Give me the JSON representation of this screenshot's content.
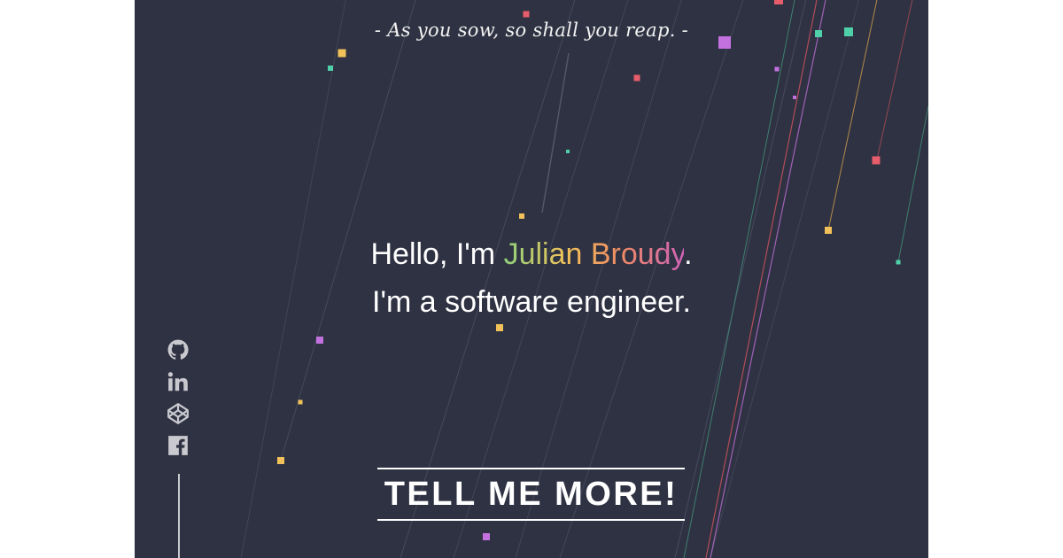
{
  "quote": "- As you sow, so shall you reap. -",
  "headline": {
    "greeting_prefix": "Hello, I'm ",
    "name": "Julian Broudy",
    "greeting_suffix": ".",
    "tagline": "I'm a software engineer."
  },
  "social": [
    {
      "name": "github",
      "icon": "github-icon"
    },
    {
      "name": "linkedin",
      "icon": "linkedin-icon"
    },
    {
      "name": "codepen",
      "icon": "codepen-icon"
    },
    {
      "name": "facebook",
      "icon": "facebook-icon"
    }
  ],
  "cta_label": "TELL ME MORE!",
  "colors": {
    "background": "#2f3242",
    "text": "#ffffff",
    "icons": "#c9c9cf",
    "particles": [
      "#f2c15a",
      "#e85d6b",
      "#c471e0",
      "#4fd0a8"
    ]
  }
}
